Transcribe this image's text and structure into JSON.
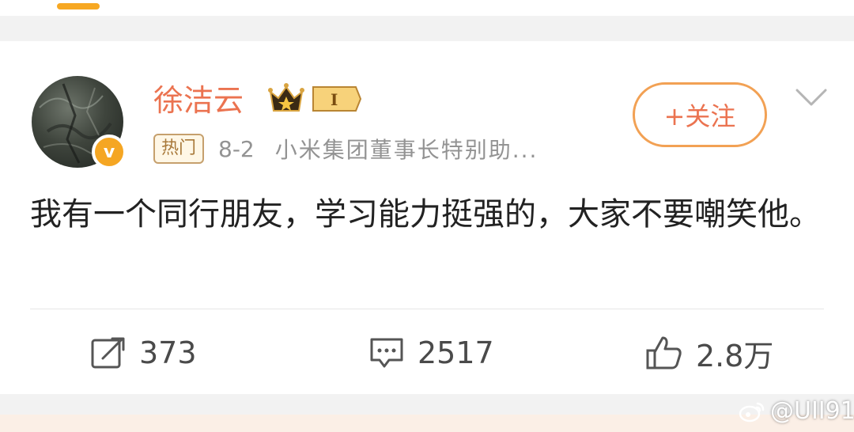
{
  "post": {
    "author": "徐洁云",
    "member_level": "I",
    "tag": "热门",
    "date": "8-2",
    "source": "小米集团董事长特别助...",
    "follow_label": "+关注",
    "text": "我有一个同行朋友，学习能力挺强的，大家不要嘲笑他。",
    "verified_letter": "v"
  },
  "actions": {
    "repost_count": "373",
    "comment_count": "2517",
    "like_count": "2.8万"
  },
  "watermark": "@UII91",
  "colors": {
    "accent": "#eb7350",
    "follow_border": "#f2a154",
    "badge": "#f5a623",
    "background": "#f2f2f2"
  }
}
